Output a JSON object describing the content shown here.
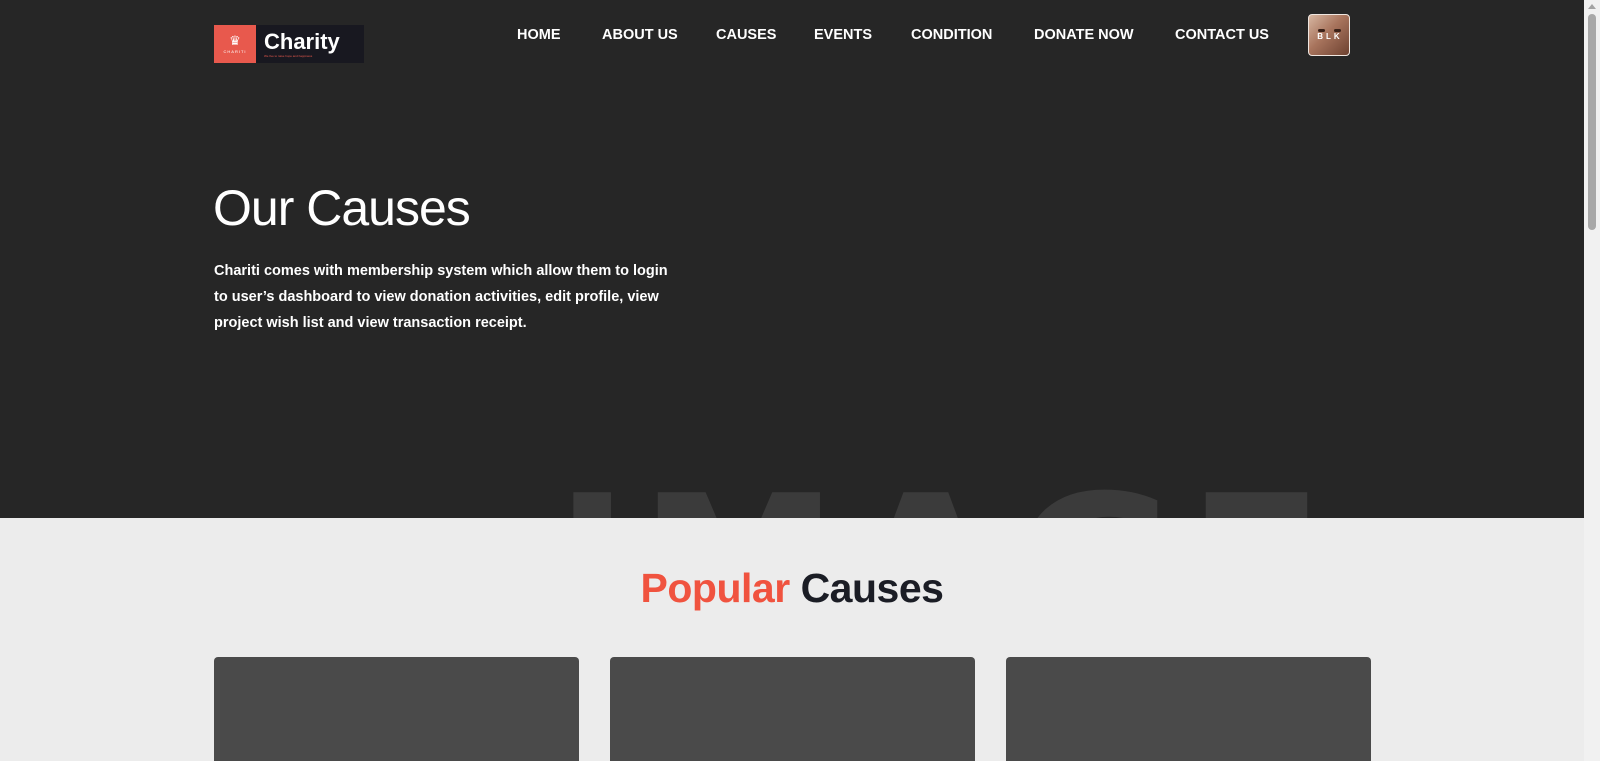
{
  "logo": {
    "title": "Charity",
    "mark_text": "CHARITI",
    "tagline": "We live to raise hope and happiness",
    "icon": "crown-icon"
  },
  "nav": {
    "items": [
      {
        "label": "HOME"
      },
      {
        "label": "ABOUT US"
      },
      {
        "label": "CAUSES"
      },
      {
        "label": "EVENTS"
      },
      {
        "label": "CONDITION"
      },
      {
        "label": "DONATE NOW"
      },
      {
        "label": "CONTACT US"
      }
    ],
    "avatar_text": "BLK"
  },
  "hero": {
    "title": "Our Causes",
    "description": "Chariti comes with membership system which allow them to login to user’s dashboard to view donation activities, edit profile, view project wish list and view transaction receipt.",
    "watermark": "IMAGE"
  },
  "popular": {
    "title_accent": "Popular",
    "title_rest": "Causes",
    "card_count": 3
  },
  "colors": {
    "hero_bg": "#262626",
    "accent": "#f0533f",
    "section_bg": "#ececec",
    "card_bg": "#4a4a4a",
    "dark_text": "#1b1d25"
  }
}
